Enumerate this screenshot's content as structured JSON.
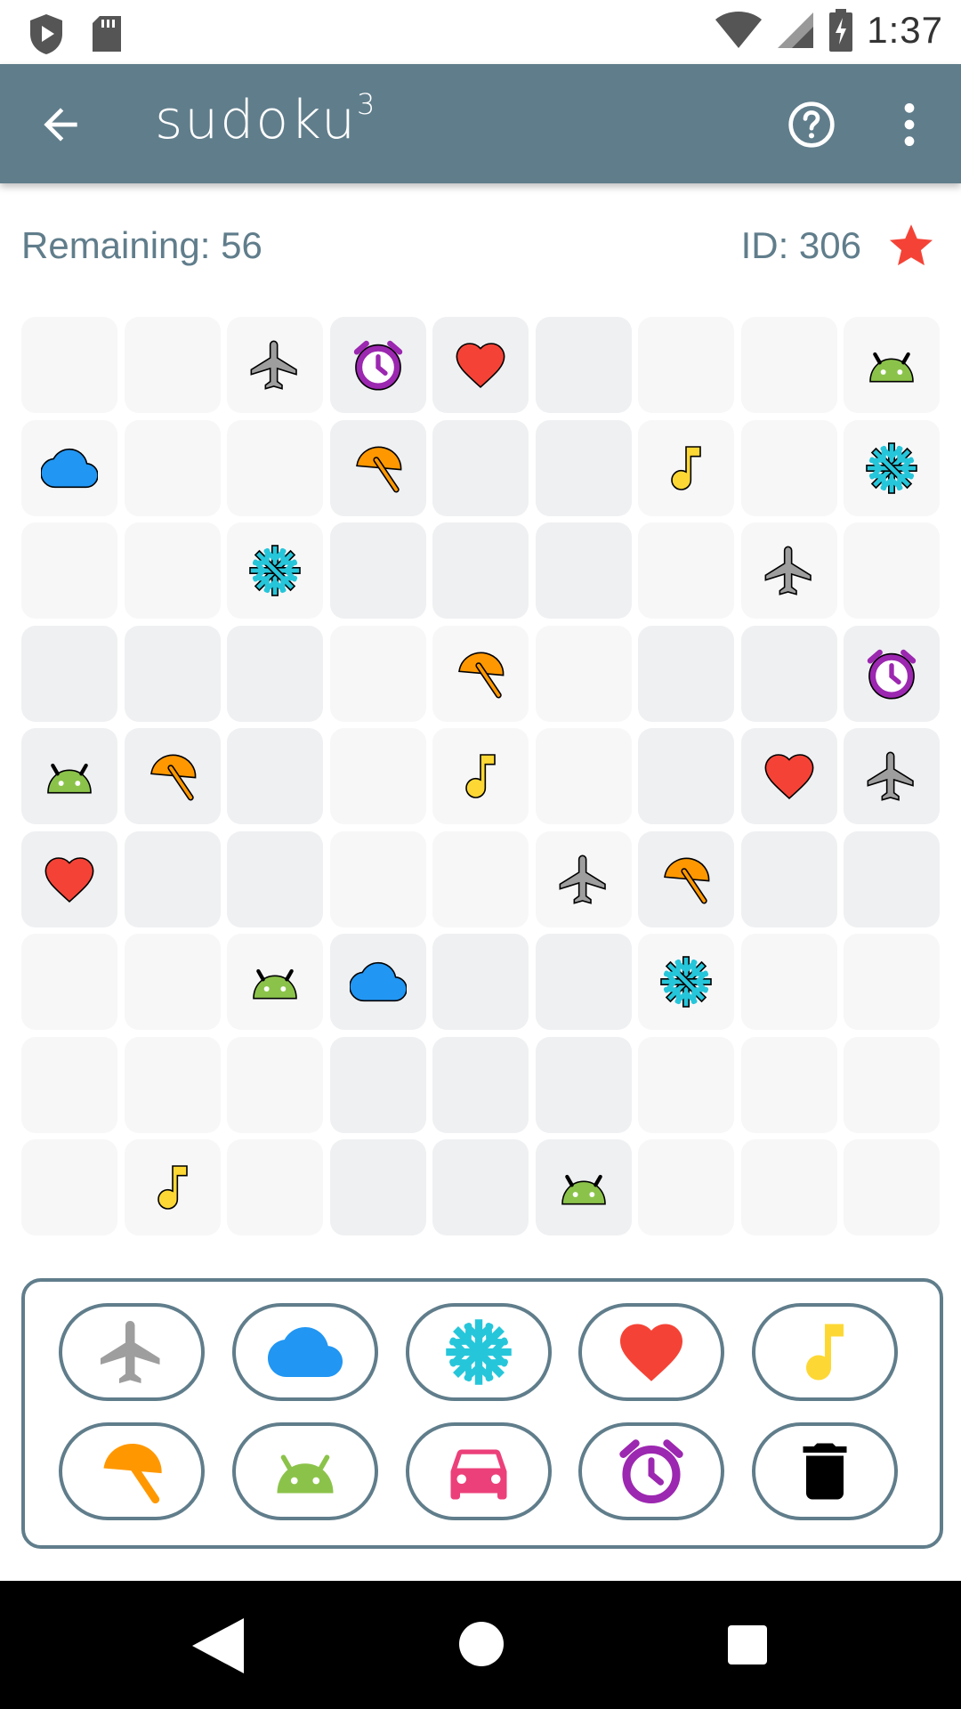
{
  "status_bar": {
    "time": "1:37",
    "icons": [
      "shield-play-icon",
      "sd-card-icon",
      "wifi-icon",
      "cell-signal-icon",
      "battery-charging-icon"
    ]
  },
  "app_bar": {
    "title": "sudoku",
    "title_superscript": "3",
    "back_icon": "arrow-left-icon",
    "help_icon": "help-circle-icon",
    "menu_icon": "more-vertical-icon",
    "color": "#607D8B"
  },
  "info": {
    "remaining": "Remaining: 56",
    "id": "ID: 306",
    "favorite_icon": "star-icon",
    "favorite_color": "#F44336"
  },
  "board": {
    "rows": [
      [
        "",
        "",
        "plane",
        "alarm",
        "heart",
        "",
        "",
        "",
        "android"
      ],
      [
        "cloud",
        "",
        "",
        "umbrella",
        "",
        "",
        "music",
        "",
        "snowflake"
      ],
      [
        "",
        "",
        "snowflake",
        "",
        "",
        "",
        "",
        "plane",
        ""
      ],
      [
        "",
        "",
        "",
        "",
        "umbrella",
        "",
        "",
        "",
        "alarm"
      ],
      [
        "android",
        "umbrella",
        "",
        "",
        "music",
        "",
        "",
        "heart",
        "plane"
      ],
      [
        "heart",
        "",
        "",
        "",
        "",
        "plane",
        "umbrella",
        "",
        ""
      ],
      [
        "",
        "",
        "android",
        "cloud",
        "",
        "",
        "snowflake",
        "",
        ""
      ],
      [
        "",
        "",
        "",
        "",
        "",
        "",
        "",
        "",
        ""
      ],
      [
        "",
        "music",
        "",
        "",
        "",
        "android",
        "",
        "",
        ""
      ]
    ]
  },
  "palette": {
    "buttons": [
      {
        "icon": "plane",
        "color": "#9E9E9E"
      },
      {
        "icon": "cloud",
        "color": "#2196F3"
      },
      {
        "icon": "snowflake",
        "color": "#26C6DA"
      },
      {
        "icon": "heart",
        "color": "#F44336"
      },
      {
        "icon": "music",
        "color": "#FDD835"
      },
      {
        "icon": "umbrella",
        "color": "#FF9800"
      },
      {
        "icon": "android",
        "color": "#8BC34A"
      },
      {
        "icon": "car",
        "color": "#EC407A"
      },
      {
        "icon": "alarm",
        "color": "#9C27B0"
      },
      {
        "icon": "trash",
        "color": "#000000"
      }
    ]
  },
  "nav_bar": {
    "back_icon": "nav-back-icon",
    "home_icon": "nav-home-icon",
    "recent_icon": "nav-recent-icon"
  }
}
